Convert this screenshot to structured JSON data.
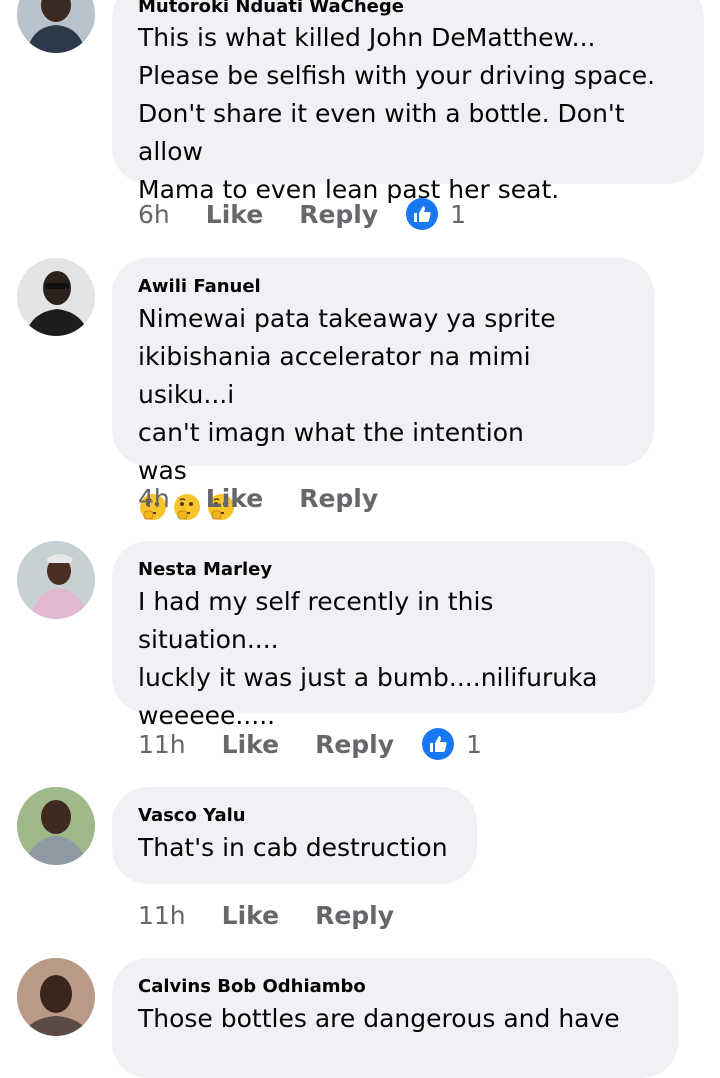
{
  "comments": [
    {
      "author": "Mutoroki Nduati WaChege",
      "text": "This is what killed John DeMatthew...\nPlease be selfish with your driving space.\nDon't share it even with a bottle. Don't allow\nMama to even lean past her seat.",
      "time": "6h",
      "like_label": "Like",
      "reply_label": "Reply",
      "reaction_count": "1"
    },
    {
      "author": "Awili Fanuel",
      "text": "Nimewai pata takeaway ya sprite\nikibishania accelerator na mimi usiku...i\ncan't imagn what the intention\nwas",
      "emoji": [
        "thinking-face",
        "thinking-face",
        "thinking-face"
      ],
      "time": "4h",
      "like_label": "Like",
      "reply_label": "Reply"
    },
    {
      "author": "Nesta Marley",
      "text": "I had my self recently in this situation....\nluckly it was just a bumb....nilifuruka\nweeeee.....",
      "time": "11h",
      "like_label": "Like",
      "reply_label": "Reply",
      "reaction_count": "1"
    },
    {
      "author": "Vasco Yalu",
      "text": "That's in cab destruction",
      "time": "11h",
      "like_label": "Like",
      "reply_label": "Reply"
    },
    {
      "author": "Calvins Bob Odhiambo",
      "text": "Those bottles are dangerous and have"
    }
  ],
  "colors": {
    "bubble": "#eff1f4",
    "meta_text": "#65676b",
    "like_blue": "#1877f2",
    "text": "#050505"
  },
  "icons": {
    "reaction": "thumbs-up-icon",
    "emoji": "thinking-face-icon"
  }
}
